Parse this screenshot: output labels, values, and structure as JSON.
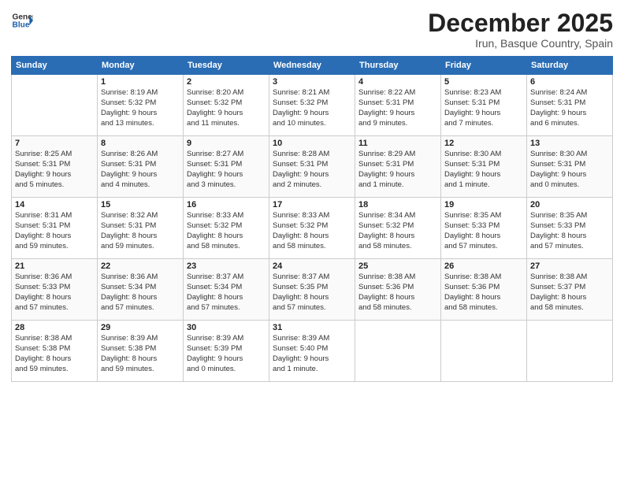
{
  "header": {
    "logo_line1": "General",
    "logo_line2": "Blue",
    "month": "December 2025",
    "location": "Irun, Basque Country, Spain"
  },
  "weekdays": [
    "Sunday",
    "Monday",
    "Tuesday",
    "Wednesday",
    "Thursday",
    "Friday",
    "Saturday"
  ],
  "weeks": [
    [
      {
        "day": "",
        "info": ""
      },
      {
        "day": "1",
        "info": "Sunrise: 8:19 AM\nSunset: 5:32 PM\nDaylight: 9 hours\nand 13 minutes."
      },
      {
        "day": "2",
        "info": "Sunrise: 8:20 AM\nSunset: 5:32 PM\nDaylight: 9 hours\nand 11 minutes."
      },
      {
        "day": "3",
        "info": "Sunrise: 8:21 AM\nSunset: 5:32 PM\nDaylight: 9 hours\nand 10 minutes."
      },
      {
        "day": "4",
        "info": "Sunrise: 8:22 AM\nSunset: 5:31 PM\nDaylight: 9 hours\nand 9 minutes."
      },
      {
        "day": "5",
        "info": "Sunrise: 8:23 AM\nSunset: 5:31 PM\nDaylight: 9 hours\nand 7 minutes."
      },
      {
        "day": "6",
        "info": "Sunrise: 8:24 AM\nSunset: 5:31 PM\nDaylight: 9 hours\nand 6 minutes."
      }
    ],
    [
      {
        "day": "7",
        "info": "Sunrise: 8:25 AM\nSunset: 5:31 PM\nDaylight: 9 hours\nand 5 minutes."
      },
      {
        "day": "8",
        "info": "Sunrise: 8:26 AM\nSunset: 5:31 PM\nDaylight: 9 hours\nand 4 minutes."
      },
      {
        "day": "9",
        "info": "Sunrise: 8:27 AM\nSunset: 5:31 PM\nDaylight: 9 hours\nand 3 minutes."
      },
      {
        "day": "10",
        "info": "Sunrise: 8:28 AM\nSunset: 5:31 PM\nDaylight: 9 hours\nand 2 minutes."
      },
      {
        "day": "11",
        "info": "Sunrise: 8:29 AM\nSunset: 5:31 PM\nDaylight: 9 hours\nand 1 minute."
      },
      {
        "day": "12",
        "info": "Sunrise: 8:30 AM\nSunset: 5:31 PM\nDaylight: 9 hours\nand 1 minute."
      },
      {
        "day": "13",
        "info": "Sunrise: 8:30 AM\nSunset: 5:31 PM\nDaylight: 9 hours\nand 0 minutes."
      }
    ],
    [
      {
        "day": "14",
        "info": "Sunrise: 8:31 AM\nSunset: 5:31 PM\nDaylight: 8 hours\nand 59 minutes."
      },
      {
        "day": "15",
        "info": "Sunrise: 8:32 AM\nSunset: 5:31 PM\nDaylight: 8 hours\nand 59 minutes."
      },
      {
        "day": "16",
        "info": "Sunrise: 8:33 AM\nSunset: 5:32 PM\nDaylight: 8 hours\nand 58 minutes."
      },
      {
        "day": "17",
        "info": "Sunrise: 8:33 AM\nSunset: 5:32 PM\nDaylight: 8 hours\nand 58 minutes."
      },
      {
        "day": "18",
        "info": "Sunrise: 8:34 AM\nSunset: 5:32 PM\nDaylight: 8 hours\nand 58 minutes."
      },
      {
        "day": "19",
        "info": "Sunrise: 8:35 AM\nSunset: 5:33 PM\nDaylight: 8 hours\nand 57 minutes."
      },
      {
        "day": "20",
        "info": "Sunrise: 8:35 AM\nSunset: 5:33 PM\nDaylight: 8 hours\nand 57 minutes."
      }
    ],
    [
      {
        "day": "21",
        "info": "Sunrise: 8:36 AM\nSunset: 5:33 PM\nDaylight: 8 hours\nand 57 minutes."
      },
      {
        "day": "22",
        "info": "Sunrise: 8:36 AM\nSunset: 5:34 PM\nDaylight: 8 hours\nand 57 minutes."
      },
      {
        "day": "23",
        "info": "Sunrise: 8:37 AM\nSunset: 5:34 PM\nDaylight: 8 hours\nand 57 minutes."
      },
      {
        "day": "24",
        "info": "Sunrise: 8:37 AM\nSunset: 5:35 PM\nDaylight: 8 hours\nand 57 minutes."
      },
      {
        "day": "25",
        "info": "Sunrise: 8:38 AM\nSunset: 5:36 PM\nDaylight: 8 hours\nand 58 minutes."
      },
      {
        "day": "26",
        "info": "Sunrise: 8:38 AM\nSunset: 5:36 PM\nDaylight: 8 hours\nand 58 minutes."
      },
      {
        "day": "27",
        "info": "Sunrise: 8:38 AM\nSunset: 5:37 PM\nDaylight: 8 hours\nand 58 minutes."
      }
    ],
    [
      {
        "day": "28",
        "info": "Sunrise: 8:38 AM\nSunset: 5:38 PM\nDaylight: 8 hours\nand 59 minutes."
      },
      {
        "day": "29",
        "info": "Sunrise: 8:39 AM\nSunset: 5:38 PM\nDaylight: 8 hours\nand 59 minutes."
      },
      {
        "day": "30",
        "info": "Sunrise: 8:39 AM\nSunset: 5:39 PM\nDaylight: 9 hours\nand 0 minutes."
      },
      {
        "day": "31",
        "info": "Sunrise: 8:39 AM\nSunset: 5:40 PM\nDaylight: 9 hours\nand 1 minute."
      },
      {
        "day": "",
        "info": ""
      },
      {
        "day": "",
        "info": ""
      },
      {
        "day": "",
        "info": ""
      }
    ]
  ]
}
